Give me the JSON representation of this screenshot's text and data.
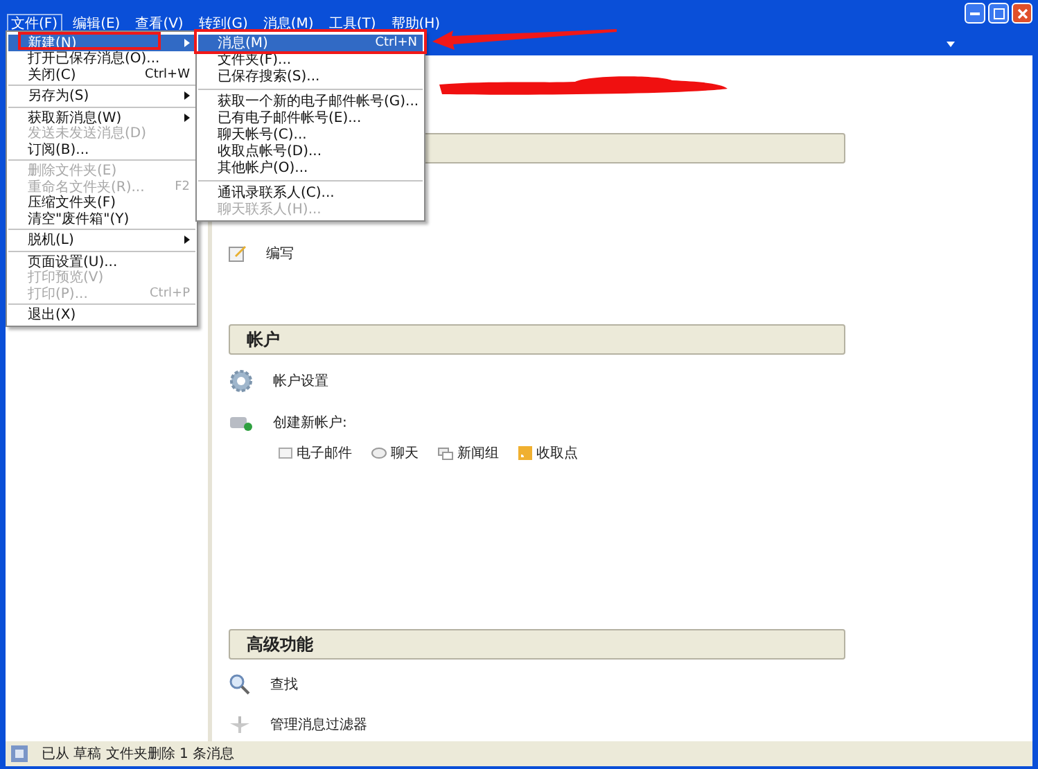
{
  "menubar": [
    {
      "label": "文件(F)",
      "selected": true
    },
    {
      "label": "编辑(E)",
      "selected": false
    },
    {
      "label": "查看(V)",
      "selected": false
    },
    {
      "label": "转到(G)",
      "selected": false
    },
    {
      "label": "消息(M)",
      "selected": false
    },
    {
      "label": "工具(T)",
      "selected": false
    },
    {
      "label": "帮助(H)",
      "selected": false
    }
  ],
  "file_menu": [
    {
      "kind": "item",
      "label": "新建(N)",
      "has_submenu": true,
      "selected": true,
      "disabled": false
    },
    {
      "kind": "item",
      "label": "打开已保存消息(O)...",
      "selected": false,
      "disabled": false
    },
    {
      "kind": "item",
      "label": "关闭(C)",
      "shortcut": "Ctrl+W",
      "selected": false,
      "disabled": false
    },
    {
      "kind": "separator"
    },
    {
      "kind": "item",
      "label": "另存为(S)",
      "has_submenu": true,
      "selected": false,
      "disabled": false
    },
    {
      "kind": "separator"
    },
    {
      "kind": "item",
      "label": "获取新消息(W)",
      "has_submenu": true,
      "selected": false,
      "disabled": false
    },
    {
      "kind": "item",
      "label": "发送未发送消息(D)",
      "selected": false,
      "disabled": true
    },
    {
      "kind": "item",
      "label": "订阅(B)...",
      "selected": false,
      "disabled": false
    },
    {
      "kind": "separator"
    },
    {
      "kind": "item",
      "label": "删除文件夹(E)",
      "selected": false,
      "disabled": true
    },
    {
      "kind": "item",
      "label": "重命名文件夹(R)...",
      "shortcut": "F2",
      "selected": false,
      "disabled": true
    },
    {
      "kind": "item",
      "label": "压缩文件夹(F)",
      "selected": false,
      "disabled": false
    },
    {
      "kind": "item",
      "label": "清空\"废件箱\"(Y)",
      "selected": false,
      "disabled": false
    },
    {
      "kind": "separator"
    },
    {
      "kind": "item",
      "label": "脱机(L)",
      "has_submenu": true,
      "selected": false,
      "disabled": false
    },
    {
      "kind": "separator"
    },
    {
      "kind": "item",
      "label": "页面设置(U)...",
      "selected": false,
      "disabled": false
    },
    {
      "kind": "item",
      "label": "打印预览(V)",
      "selected": false,
      "disabled": true
    },
    {
      "kind": "item",
      "label": "打印(P)...",
      "shortcut": "Ctrl+P",
      "selected": false,
      "disabled": true
    },
    {
      "kind": "separator"
    },
    {
      "kind": "item",
      "label": "退出(X)",
      "selected": false,
      "disabled": false
    }
  ],
  "new_submenu": [
    {
      "kind": "item",
      "label": "消息(M)",
      "shortcut": "Ctrl+N",
      "selected": true,
      "disabled": false
    },
    {
      "kind": "item",
      "label": "文件夹(F)...",
      "selected": false,
      "disabled": false
    },
    {
      "kind": "item",
      "label": "已保存搜索(S)...",
      "selected": false,
      "disabled": false
    },
    {
      "kind": "separator"
    },
    {
      "kind": "item",
      "label": "获取一个新的电子邮件帐号(G)...",
      "selected": false,
      "disabled": false
    },
    {
      "kind": "item",
      "label": "已有电子邮件帐号(E)...",
      "selected": false,
      "disabled": false
    },
    {
      "kind": "item",
      "label": "聊天帐号(C)...",
      "selected": false,
      "disabled": false
    },
    {
      "kind": "item",
      "label": "收取点帐号(D)...",
      "selected": false,
      "disabled": false
    },
    {
      "kind": "item",
      "label": "其他帐户(O)...",
      "selected": false,
      "disabled": false
    },
    {
      "kind": "separator"
    },
    {
      "kind": "item",
      "label": "通讯录联系人(C)...",
      "selected": false,
      "disabled": false
    },
    {
      "kind": "item",
      "label": "聊天联系人(H)...",
      "selected": false,
      "disabled": true
    }
  ],
  "sections": [
    {
      "items": [
        {
          "kind": "compose",
          "label": "编写"
        }
      ]
    },
    {
      "title": "帐户",
      "items": [
        {
          "kind": "settings",
          "label": "帐户设置"
        },
        {
          "kind": "create",
          "label": "创建新帐户:",
          "links": [
            {
              "kind": "email",
              "label": "电子邮件"
            },
            {
              "kind": "chat",
              "label": "聊天"
            },
            {
              "kind": "newsgroup",
              "label": "新闻组"
            },
            {
              "kind": "feed",
              "label": "收取点"
            }
          ]
        }
      ]
    },
    {
      "title": "高级功能",
      "items": [
        {
          "kind": "search",
          "label": "查找"
        },
        {
          "kind": "filter",
          "label": "管理消息过滤器"
        }
      ]
    }
  ],
  "status_bar": {
    "text": "已从 草稿 文件夹删除 1 条消息"
  }
}
